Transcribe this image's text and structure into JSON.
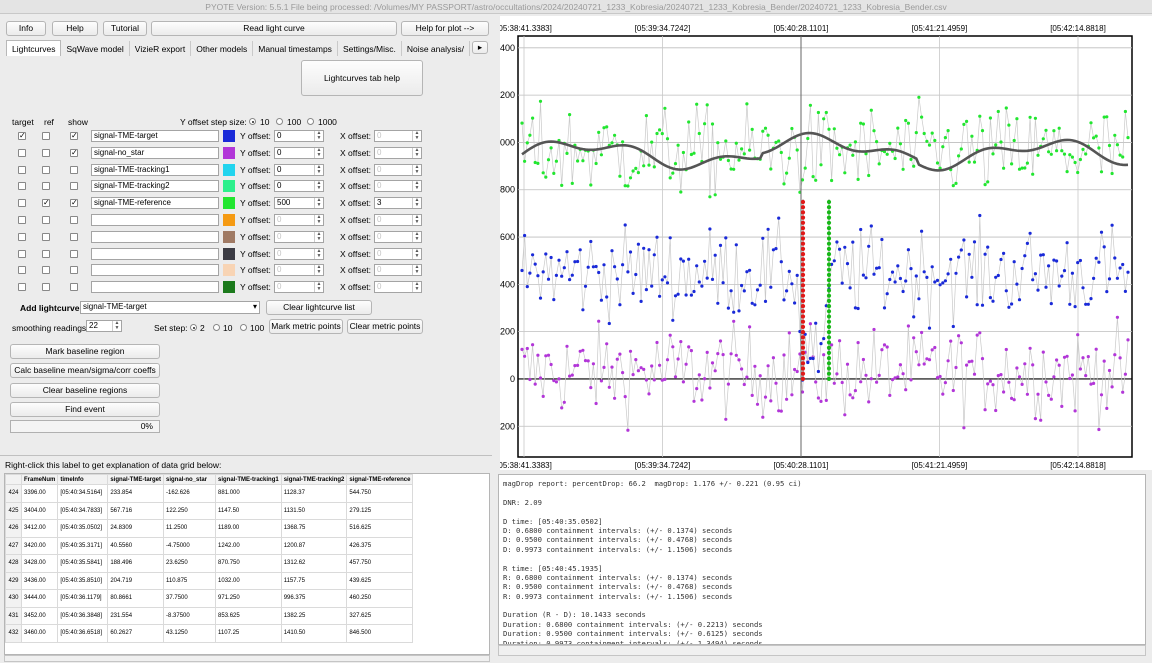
{
  "window": {
    "title": "PYOTE Version: 5.5.1  File being processed: /Volumes/MY PASSPORT/astro/occultations/2024/20240721_1233_Kobresia/20240721_1233_Kobresia_Bender/20240721_1233_Kobresia_Bender.csv"
  },
  "toolbar": {
    "info": "Info",
    "help": "Help",
    "tutorial": "Tutorial",
    "read_light_curve": "Read light curve",
    "help_for_plot": "Help for plot -->"
  },
  "tabs": [
    "Lightcurves",
    "SqWave model",
    "VizieR export",
    "Other models",
    "Manual timestamps",
    "Settings/Misc.",
    "Noise analysis/"
  ],
  "lightcurves_tab_help": "Lightcurves tab help",
  "headers": {
    "target": "target",
    "ref": "ref",
    "show": "show"
  },
  "y_offset_step_label": "Y offset step size:",
  "y_offset_steps": [
    "10",
    "100",
    "1000"
  ],
  "y_offset_label": "Y offset:",
  "x_offset_label": "X offset:",
  "rows": [
    {
      "target": true,
      "ref": false,
      "show": true,
      "name": "signal-TME-target",
      "color": "#1a2ad8",
      "yoff": "0",
      "xoff": "0",
      "enabled": true
    },
    {
      "target": false,
      "ref": false,
      "show": true,
      "name": "signal-no_star",
      "color": "#b236d8",
      "yoff": "0",
      "xoff": "0",
      "enabled": true
    },
    {
      "target": false,
      "ref": false,
      "show": false,
      "name": "signal-TME-tracking1",
      "color": "#22d4ee",
      "yoff": "0",
      "xoff": "0",
      "enabled": true
    },
    {
      "target": false,
      "ref": false,
      "show": false,
      "name": "signal-TME-tracking2",
      "color": "#2cf08c",
      "yoff": "0",
      "xoff": "0",
      "enabled": true
    },
    {
      "target": false,
      "ref": true,
      "show": true,
      "name": "signal-TME-reference",
      "color": "#22e630",
      "yoff": "500",
      "xoff": "3",
      "enabled": true
    },
    {
      "target": false,
      "ref": false,
      "show": false,
      "name": "",
      "color": "#f59a12",
      "yoff": "0",
      "xoff": "0",
      "enabled": false
    },
    {
      "target": false,
      "ref": false,
      "show": false,
      "name": "",
      "color": "#a07a64",
      "yoff": "0",
      "xoff": "0",
      "enabled": false
    },
    {
      "target": false,
      "ref": false,
      "show": false,
      "name": "",
      "color": "#3c3c44",
      "yoff": "0",
      "xoff": "0",
      "enabled": false
    },
    {
      "target": false,
      "ref": false,
      "show": false,
      "name": "",
      "color": "#f8d4b4",
      "yoff": "0",
      "xoff": "0",
      "enabled": false
    },
    {
      "target": false,
      "ref": false,
      "show": false,
      "name": "",
      "color": "#1c7a1c",
      "yoff": "0",
      "xoff": "0",
      "enabled": false
    }
  ],
  "add_lightcurve_label": "Add lightcurve",
  "add_lightcurve_value": "signal-TME-target",
  "clear_lightcurve_list": "Clear lightcurve list",
  "smoothing_label": "smoothing readings",
  "smoothing_value": "22",
  "set_step_label": "Set step:",
  "set_steps": [
    "2",
    "10",
    "100"
  ],
  "mark_metric_points": "Mark metric points",
  "clear_metric_points": "Clear metric points",
  "mark_baseline_region": "Mark baseline region",
  "calc_baseline": "Calc baseline mean/sigma/corr coeffs",
  "clear_baseline_regions": "Clear baseline regions",
  "find_event": "Find event",
  "progress": "0%",
  "grid_hint": "Right-click this label to get explanation of data grid below:",
  "grid": {
    "columns": [
      "FrameNum",
      "timeInfo",
      "signal-TME-target",
      "signal-no_star",
      "signal-TME-tracking1",
      "signal-TME-tracking2",
      "signal-TME-reference"
    ],
    "rows": [
      {
        "n": "424",
        "cells": [
          "3396.00",
          "[05:40:34.5164]",
          "233.854",
          "-162.626",
          "881.000",
          "1128.37",
          "544.750"
        ]
      },
      {
        "n": "425",
        "cells": [
          "3404.00",
          "[05:40:34.7833]",
          "567.716",
          "122.250",
          "1147.50",
          "1131.50",
          "279.125"
        ]
      },
      {
        "n": "426",
        "cells": [
          "3412.00",
          "[05:40:35.0502]",
          "24.8309",
          "11.2500",
          "1189.00",
          "1368.75",
          "516.625"
        ]
      },
      {
        "n": "427",
        "cells": [
          "3420.00",
          "[05:40:35.3171]",
          "40.5560",
          "-4.75000",
          "1242.00",
          "1200.87",
          "426.375"
        ]
      },
      {
        "n": "428",
        "cells": [
          "3428.00",
          "[05:40:35.5841]",
          "188.496",
          "23.6250",
          "870.750",
          "1312.62",
          "457.750"
        ]
      },
      {
        "n": "429",
        "cells": [
          "3436.00",
          "[05:40:35.8510]",
          "204.719",
          "110.875",
          "1032.00",
          "1157.75",
          "439.625"
        ]
      },
      {
        "n": "430",
        "cells": [
          "3444.00",
          "[05:40:36.1179]",
          "80.8661",
          "37.7500",
          "971.250",
          "996.375",
          "460.250"
        ]
      },
      {
        "n": "431",
        "cells": [
          "3452.00",
          "[05:40:36.3848]",
          "231.554",
          "-8.37500",
          "853.625",
          "1382.25",
          "327.625"
        ]
      },
      {
        "n": "432",
        "cells": [
          "3460.00",
          "[05:40:36.6518]",
          "60.2627",
          "43.1250",
          "1107.25",
          "1410.50",
          "846.500"
        ]
      }
    ]
  },
  "report": [
    "magDrop report: percentDrop: 66.2  magDrop: 1.176 +/- 0.221 (0.95 ci)",
    "",
    "DNR: 2.09",
    "",
    "D time: [05:40:35.0502]",
    "D: 0.6800 containment intervals: (+/- 0.1374) seconds",
    "D: 0.9500 containment intervals: (+/- 0.4768) seconds",
    "D: 0.9973 containment intervals: (+/- 1.1506) seconds",
    "",
    "R time: [05:40:45.1935]",
    "R: 0.6800 containment intervals: (+/- 0.1374) seconds",
    "R: 0.9500 containment intervals: (+/- 0.4768) seconds",
    "R: 0.9973 containment intervals: (+/- 1.1506) seconds",
    "",
    "Duration (R - D): 10.1433 seconds",
    "Duration: 0.6800 containment intervals: (+/- 0.2213) seconds",
    "Duration: 0.9500 containment intervals: (+/- 0.6125) seconds",
    "Duration: 0.9973 containment intervals: (+/- 1.3494) seconds"
  ],
  "chart_data": {
    "type": "scatter",
    "x_tick_labels": [
      "[05:38:41.3383]",
      "[05:39:34.7242]",
      "[05:40:28.1101]",
      "[05:41:21.4959]",
      "[05:42:14.8818]"
    ],
    "y_ticks": [
      -200,
      0,
      200,
      400,
      600,
      800,
      1000,
      1200,
      1400
    ],
    "ylim": [
      -330,
      1450
    ],
    "grid": true,
    "cursor_time": "[05:40:28.1101]",
    "series": [
      {
        "name": "signal-TME-target",
        "color": "#1a2ad8",
        "baseline": 450,
        "sigma": 95,
        "event_start_time": "[05:40:35.0502]",
        "event_end_time": "[05:40:45.1935]",
        "event_level": 120
      },
      {
        "name": "signal-no_star",
        "color": "#b236d8",
        "baseline": 30,
        "sigma": 95
      },
      {
        "name": "signal-TME-reference",
        "color": "#22e630",
        "baseline": 960,
        "sigma": 95
      },
      {
        "name": "smoothed reference",
        "color": "#555555",
        "baseline": 950
      }
    ],
    "metric_points": [
      {
        "name": "D",
        "color": "#e01818",
        "x_time": "[05:40:35.0502]",
        "y_range": [
          0,
          760
        ]
      },
      {
        "name": "R",
        "color": "#18b818",
        "x_time": "[05:40:45.1935]",
        "y_range": [
          0,
          760
        ]
      }
    ]
  }
}
